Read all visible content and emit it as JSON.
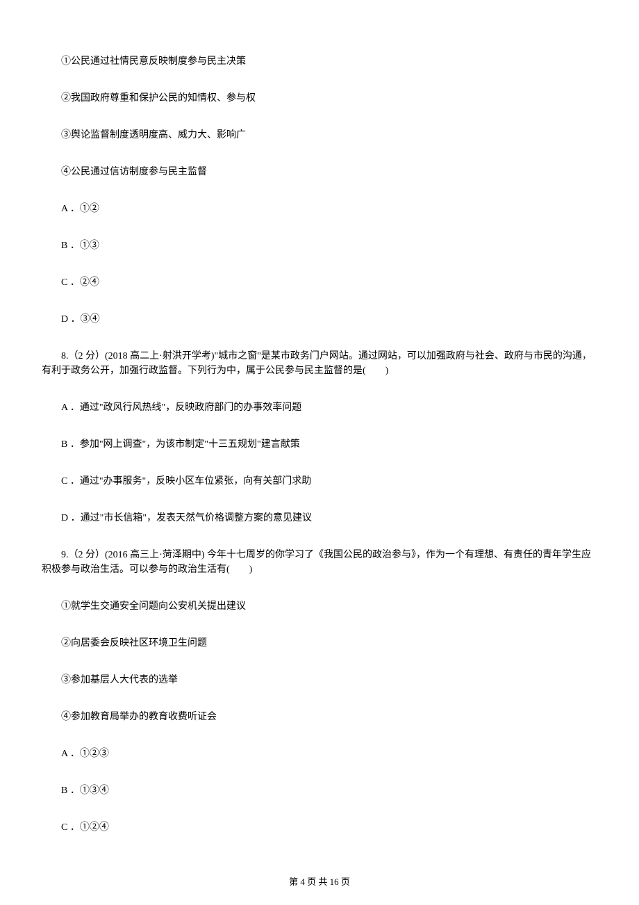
{
  "q7": {
    "stmt1": "①公民通过社情民意反映制度参与民主决策",
    "stmt2": "②我国政府尊重和保护公民的知情权、参与权",
    "stmt3": "③舆论监督制度透明度高、威力大、影响广",
    "stmt4": "④公民通过信访制度参与民主监督",
    "optA": "A ．①②",
    "optB": "B ．①③",
    "optC": "C ．②④",
    "optD": "D ．③④"
  },
  "q8": {
    "stem": "8.（2 分）(2018 高二上·射洪开学考)\"城市之窗\"是某市政务门户网站。通过网站，可以加强政府与社会、政府与市民的沟通，有利于政务公开，加强行政监督。下列行为中，属于公民参与民主监督的是(　　)",
    "optA": "A ．通过\"政风行风热线\"，反映政府部门的办事效率问题",
    "optB": "B ．参加\"网上调查\"，为该市制定\"十三五规划\"建言献策",
    "optC": "C ．通过\"办事服务\"，反映小区车位紧张，向有关部门求助",
    "optD": "D ．通过\"市长信箱\"，发表天然气价格调整方案的意见建议"
  },
  "q9": {
    "stem": "9.（2 分）(2016 高三上·菏泽期中) 今年十七周岁的你学习了《我国公民的政治参与》，作为一个有理想、有责任的青年学生应积极参与政治生活。可以参与的政治生活有(　　)",
    "stmt1": "①就学生交通安全问题向公安机关提出建议",
    "stmt2": "②向居委会反映社区环境卫生问题",
    "stmt3": "③参加基层人大代表的选举",
    "stmt4": "④参加教育局举办的教育收费听证会",
    "optA": "A ．①②③",
    "optB": "B ．①③④",
    "optC": "C ．①②④"
  },
  "footer": "第 4 页 共 16 页"
}
